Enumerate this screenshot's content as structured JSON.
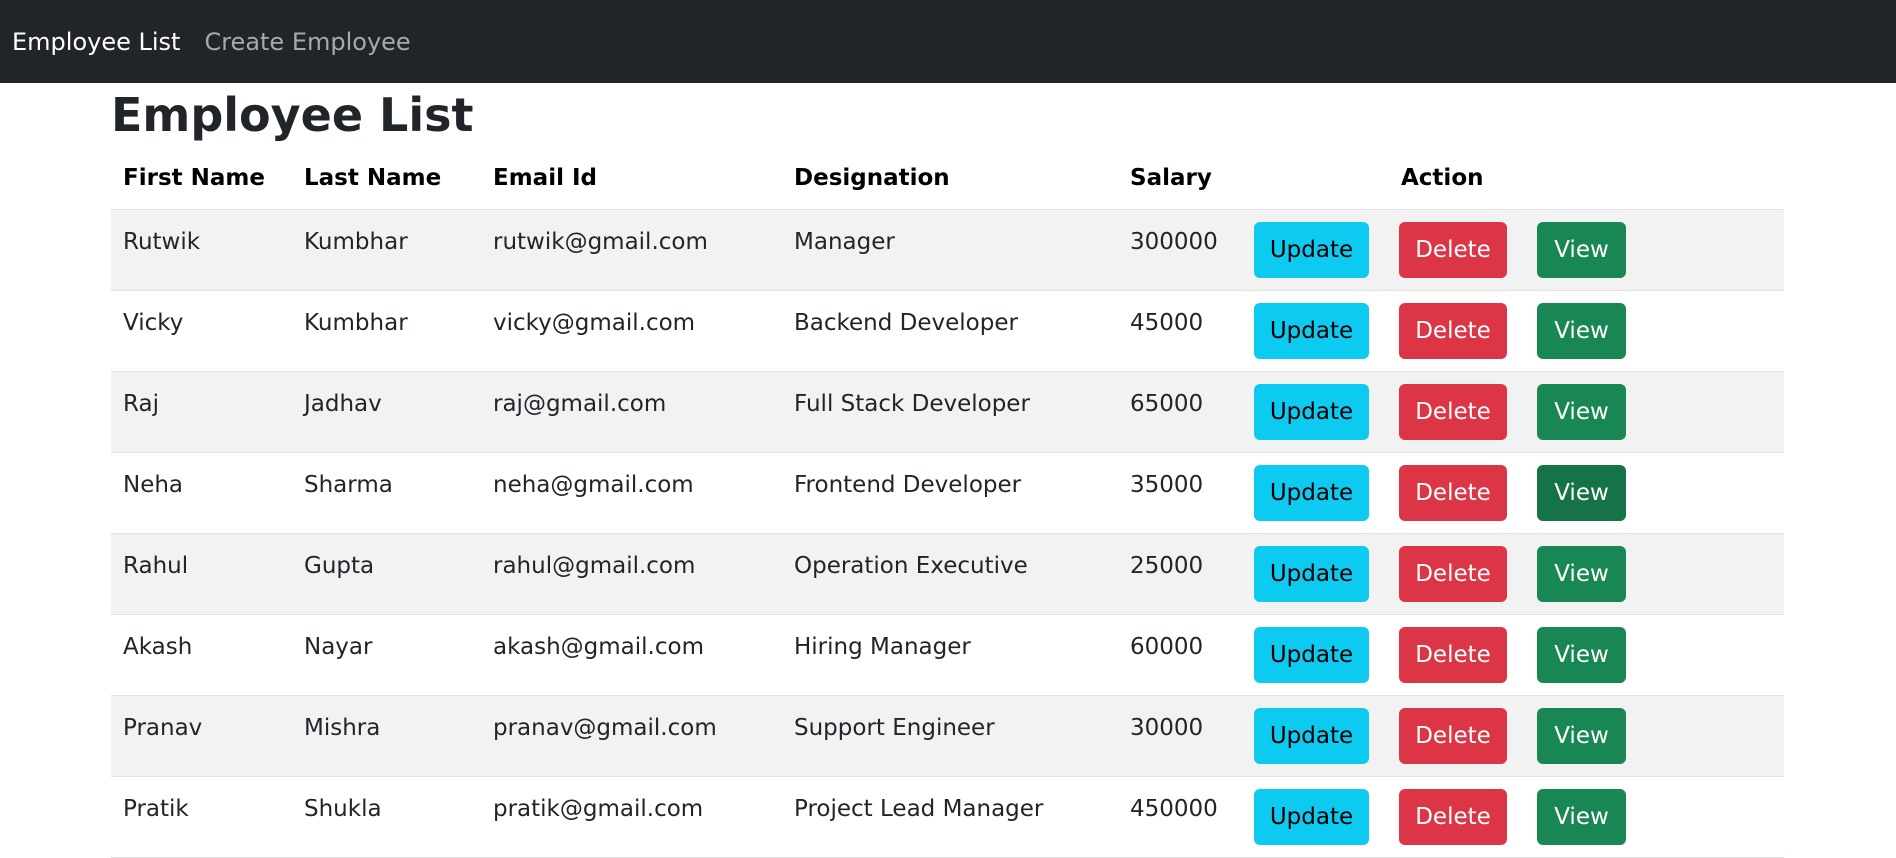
{
  "navbar": {
    "brand": "Employee List",
    "link": "Create Employee"
  },
  "page": {
    "title": "Employee List"
  },
  "table": {
    "headers": {
      "first_name": "First Name",
      "last_name": "Last Name",
      "email": "Email Id",
      "designation": "Designation",
      "salary": "Salary",
      "action": "Action"
    },
    "buttons": {
      "update": "Update",
      "delete": "Delete",
      "view": "View"
    },
    "rows": [
      {
        "first_name": "Rutwik",
        "last_name": "Kumbhar",
        "email": "rutwik@gmail.com",
        "designation": "Manager",
        "salary": "300000"
      },
      {
        "first_name": "Vicky",
        "last_name": "Kumbhar",
        "email": "vicky@gmail.com",
        "designation": "Backend Developer",
        "salary": "45000"
      },
      {
        "first_name": "Raj",
        "last_name": "Jadhav",
        "email": "raj@gmail.com",
        "designation": "Full Stack Developer",
        "salary": "65000"
      },
      {
        "first_name": "Neha",
        "last_name": "Sharma",
        "email": "neha@gmail.com",
        "designation": "Frontend Developer",
        "salary": "35000"
      },
      {
        "first_name": "Rahul",
        "last_name": "Gupta",
        "email": "rahul@gmail.com",
        "designation": "Operation Executive",
        "salary": "25000"
      },
      {
        "first_name": "Akash",
        "last_name": "Nayar",
        "email": "akash@gmail.com",
        "designation": "Hiring Manager",
        "salary": "60000"
      },
      {
        "first_name": "Pranav",
        "last_name": "Mishra",
        "email": "pranav@gmail.com",
        "designation": "Support Engineer",
        "salary": "30000"
      },
      {
        "first_name": "Pratik",
        "last_name": "Shukla",
        "email": "pratik@gmail.com",
        "designation": "Project Lead Manager",
        "salary": "450000"
      }
    ]
  },
  "colors": {
    "navbar_bg": "#212529",
    "update_btn": "#0dcaf0",
    "delete_btn": "#dc3545",
    "view_btn": "#198754",
    "view_btn_hover": "#157347",
    "stripe": "#f2f2f2"
  }
}
